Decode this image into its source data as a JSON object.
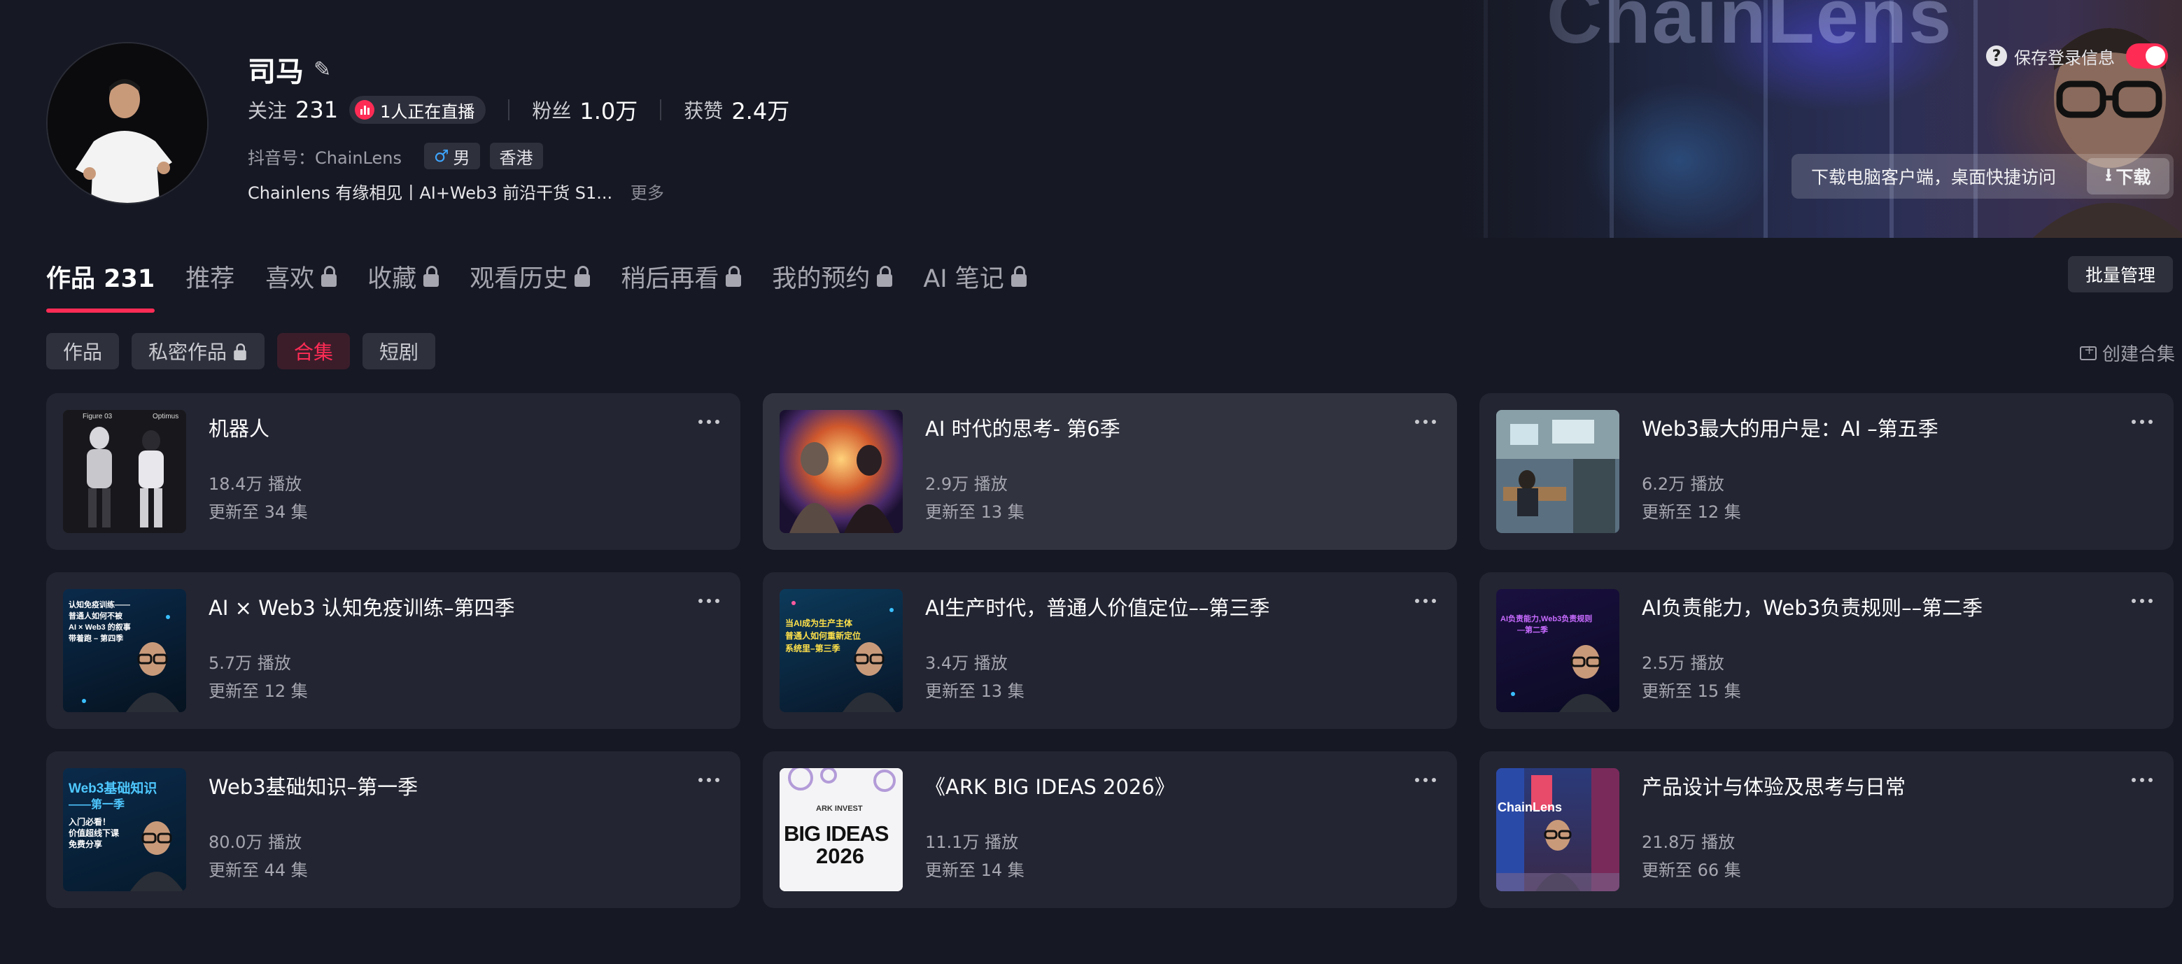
{
  "profile": {
    "name": "司马",
    "following_label": "关注",
    "following": "231",
    "live_text": "1人正在直播",
    "followers_label": "粉丝",
    "followers": "1.0万",
    "likes_label": "获赞",
    "likes": "2.4万",
    "account": "抖音号：ChainLens",
    "gender": "男",
    "region": "香港",
    "bio": "Chainlens 有缘相见丨AI+Web3 前沿干货 S1...",
    "bio_more": "更多"
  },
  "banner": {
    "logo_text": "ChainLens",
    "save_login": "保存登录信息",
    "download_text": "下载电脑客户端，桌面快捷访问",
    "download_button": "下载"
  },
  "tabs": [
    {
      "label": "作品 231",
      "active": true,
      "locked": false
    },
    {
      "label": "推荐",
      "locked": false
    },
    {
      "label": "喜欢",
      "locked": true
    },
    {
      "label": "收藏",
      "locked": true
    },
    {
      "label": "观看历史",
      "locked": true
    },
    {
      "label": "稍后再看",
      "locked": true
    },
    {
      "label": "我的预约",
      "locked": true
    },
    {
      "label": "AI 笔记",
      "locked": true
    }
  ],
  "batch_manage": "批量管理",
  "subtabs": [
    {
      "label": "作品"
    },
    {
      "label": "私密作品",
      "locked": true
    },
    {
      "label": "合集",
      "active": true
    },
    {
      "label": "短剧"
    }
  ],
  "create_collection": "创建合集",
  "collections": [
    {
      "title": "机器人",
      "plays": "18.4万 播放",
      "episodes": "更新至 34 集",
      "thumb": "robots",
      "thumb_text": [
        "Figure 03",
        "Optimus"
      ]
    },
    {
      "title": "AI 时代的思考- 第6季",
      "plays": "2.9万 播放",
      "episodes": "更新至 13 集",
      "thumb": "cosmic"
    },
    {
      "title": "Web3最大的用户是：AI –第五季",
      "plays": "6.2万 播放",
      "episodes": "更新至 12 集",
      "thumb": "office"
    },
    {
      "title": "AI × Web3 认知免疫训练–第四季",
      "plays": "5.7万 播放",
      "episodes": "更新至 12 集",
      "thumb": "blue",
      "thumb_text": [
        "认知免疫训练——",
        "普通人如何不被",
        "AI × Web3 的叙事",
        "带着跑 – 第四季"
      ]
    },
    {
      "title": "AI生产时代，普通人价值定位––第三季",
      "plays": "3.4万 播放",
      "episodes": "更新至 13 集",
      "thumb": "blue2",
      "thumb_text": [
        "当AI成为生产主体",
        "普通人如何重新定位",
        "系统里–第三季"
      ]
    },
    {
      "title": "AI负责能力，Web3负责规则––第二季",
      "plays": "2.5万 播放",
      "episodes": "更新至 15 集",
      "thumb": "purple",
      "thumb_text": [
        "AI负责能力,Web3负责规则",
        "—第二季"
      ]
    },
    {
      "title": "Web3基础知识–第一季",
      "plays": "80.0万 播放",
      "episodes": "更新至 44 集",
      "thumb": "basic",
      "thumb_text": [
        "Web3基础知识",
        "——第一季",
        "入门必看！",
        "价值超线下课",
        "免费分享"
      ]
    },
    {
      "title": "《ARK BIG IDEAS 2026》",
      "plays": "11.1万 播放",
      "episodes": "更新至 14 集",
      "thumb": "ark",
      "thumb_text": [
        "ARK INVEST",
        "BIG IDEAS",
        "2026"
      ]
    },
    {
      "title": "产品设计与体验及思考与日常",
      "plays": "21.8万 播放",
      "episodes": "更新至 66 集",
      "thumb": "city",
      "thumb_text": [
        "ChainLens"
      ]
    }
  ]
}
